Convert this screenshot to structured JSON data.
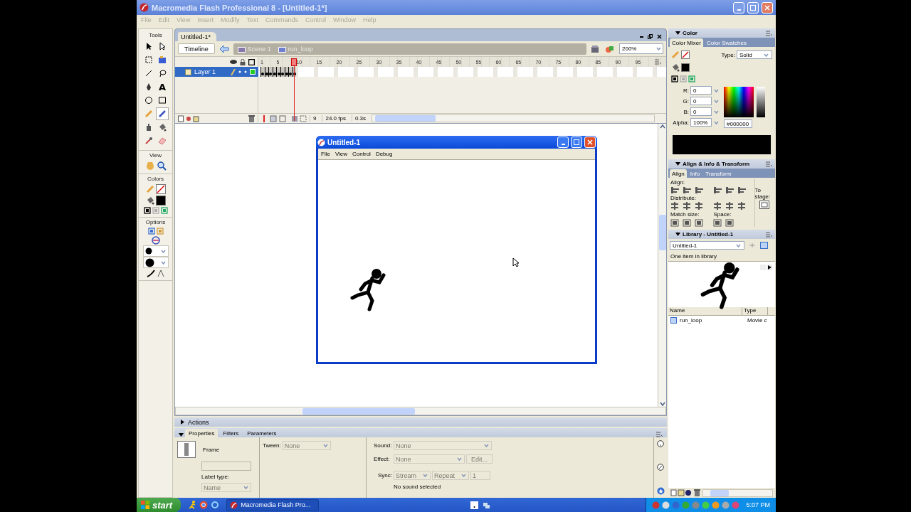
{
  "window": {
    "title": "Macromedia Flash Professional 8 - [Untitled-1*]"
  },
  "menu": [
    {
      "label": "File",
      "disabled": true
    },
    {
      "label": "Edit",
      "disabled": true
    },
    {
      "label": "View",
      "disabled": true
    },
    {
      "label": "Insert",
      "disabled": true
    },
    {
      "label": "Modify",
      "disabled": true
    },
    {
      "label": "Text",
      "disabled": true
    },
    {
      "label": "Commands",
      "disabled": true
    },
    {
      "label": "Control",
      "disabled": true
    },
    {
      "label": "Window",
      "disabled": true
    },
    {
      "label": "Help",
      "disabled": true
    }
  ],
  "tools": {
    "title": "Tools",
    "items": [
      {
        "kind": "arrow",
        "selected": false
      },
      {
        "kind": "subselect",
        "selected": false
      },
      {
        "kind": "transform",
        "selected": false
      },
      {
        "kind": "gradient",
        "selected": false
      },
      {
        "kind": "line",
        "selected": false
      },
      {
        "kind": "lasso",
        "selected": false
      },
      {
        "kind": "pen",
        "selected": false
      },
      {
        "kind": "text",
        "glyph": "A",
        "selected": false
      },
      {
        "kind": "oval",
        "selected": false
      },
      {
        "kind": "rectangle",
        "selected": false
      },
      {
        "kind": "pencil",
        "selected": false
      },
      {
        "kind": "brush",
        "selected": true
      },
      {
        "kind": "ink",
        "selected": false
      },
      {
        "kind": "bucket",
        "selected": false
      },
      {
        "kind": "eyedropper",
        "selected": false
      },
      {
        "kind": "eraser",
        "selected": false
      }
    ]
  },
  "view": {
    "title": "View"
  },
  "colors": {
    "title": "Colors"
  },
  "options": {
    "title": "Options"
  },
  "document": {
    "tab": "Untitled-1*",
    "timeline_button": "Timeline",
    "breadcrumbs": [
      "Scene 1",
      "run_loop"
    ],
    "zoom": "200%"
  },
  "timeline": {
    "frame_numbers": [
      "1",
      "5",
      "10",
      "15",
      "20",
      "25",
      "30",
      "35",
      "40",
      "45",
      "50",
      "55",
      "60",
      "65",
      "70",
      "75",
      "80",
      "85",
      "90",
      "95"
    ],
    "layers": [
      {
        "name": "Layer 1",
        "selected": true
      }
    ],
    "current_frame": "9",
    "frame_rate": "24.0 fps",
    "elapsed": "0.3s"
  },
  "player": {
    "title": "Untitled-1",
    "menu": [
      "File",
      "View",
      "Control",
      "Debug"
    ]
  },
  "actions_panel": {
    "title": "Actions",
    "expanded": false
  },
  "properties": {
    "tabs": [
      {
        "label": "Properties",
        "selected": true
      },
      {
        "label": "Filters",
        "selected": false
      },
      {
        "label": "Parameters",
        "selected": false
      }
    ],
    "frame_label": "Frame",
    "label_type_label": "Label type:",
    "label_type": "Name",
    "tween_label": "Tween:",
    "tween": "None",
    "sound_label": "Sound:",
    "sound": "None",
    "effect_label": "Effect:",
    "effect": "None",
    "edit_button": "Edit...",
    "sync_label": "Sync:",
    "sync": "Stream",
    "repeat": "Repeat",
    "repeat_count": "1",
    "sound_status": "No sound selected"
  },
  "color_panel": {
    "title": "Color",
    "tabs": [
      {
        "label": "Color Mixer",
        "selected": true
      },
      {
        "label": "Color Swatches",
        "selected": false
      }
    ],
    "type_label": "Type:",
    "type": "Solid",
    "channels": [
      {
        "label": "R:",
        "value": "0"
      },
      {
        "label": "G:",
        "value": "0"
      },
      {
        "label": "B:",
        "value": "0"
      }
    ],
    "alpha_label": "Alpha:",
    "alpha": "100%",
    "hex": "#000000"
  },
  "align_panel": {
    "title": "Align & Info & Transform",
    "tabs": [
      {
        "label": "Align",
        "selected": true
      },
      {
        "label": "Info",
        "selected": false
      },
      {
        "label": "Transform",
        "selected": false
      }
    ],
    "align_label": "Align:",
    "distribute_label": "Distribute:",
    "match_size_label": "Match size:",
    "space_label": "Space:",
    "to_stage_label": "To stage:"
  },
  "library_panel": {
    "title": "Library - Untitled-1",
    "document": "Untitled-1",
    "count": "One item in library",
    "columns": [
      "Name",
      "Type"
    ],
    "items": [
      {
        "name": "run_loop",
        "type": "Movie c"
      }
    ]
  },
  "taskbar": {
    "start": "start",
    "tasks": [
      "Macromedia Flash Pro..."
    ],
    "clock": "5:07 PM"
  }
}
